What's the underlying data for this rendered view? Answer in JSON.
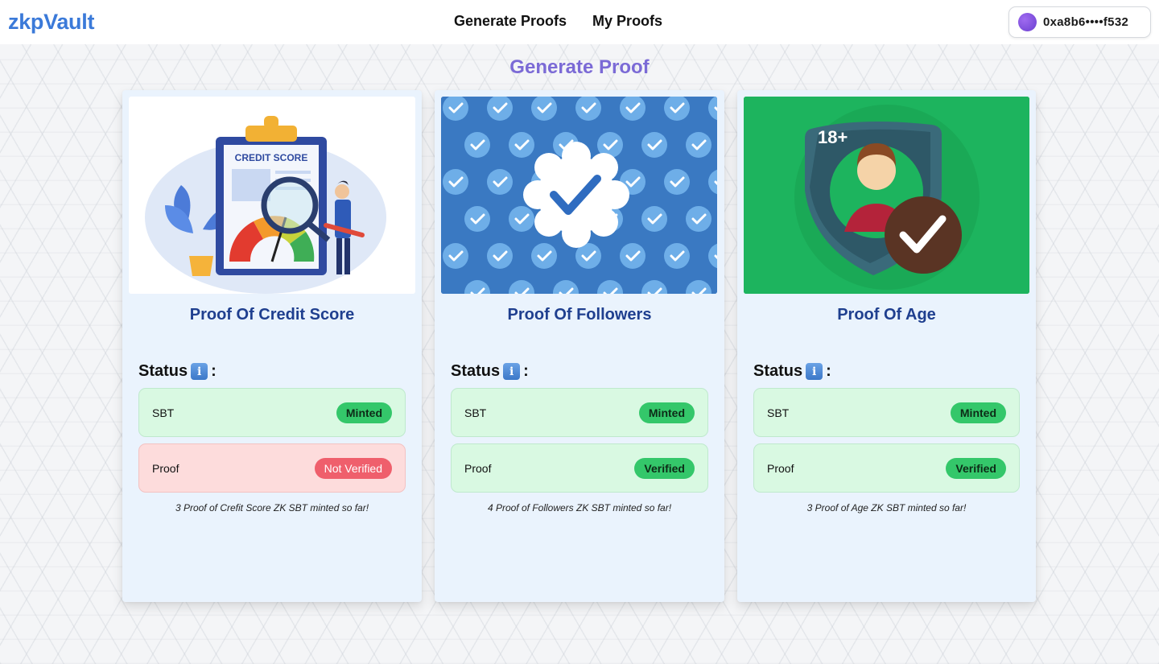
{
  "brand": "zkpVault",
  "nav": [
    {
      "label": "Generate Proofs"
    },
    {
      "label": "My Proofs"
    }
  ],
  "wallet": {
    "address": "0xa8b6••••f532"
  },
  "page_title": "Generate Proof",
  "cards": [
    {
      "title": "Proof Of Credit Score",
      "status_label": "Status",
      "image_text": "CREDIT SCORE",
      "rows": [
        {
          "label": "SBT",
          "badge": "Minted",
          "state": "ok"
        },
        {
          "label": "Proof",
          "badge": "Not Verified",
          "state": "bad"
        }
      ],
      "note": "3 Proof of Crefit Score ZK SBT minted so far!"
    },
    {
      "title": "Proof Of Followers",
      "status_label": "Status",
      "rows": [
        {
          "label": "SBT",
          "badge": "Minted",
          "state": "ok"
        },
        {
          "label": "Proof",
          "badge": "Verified",
          "state": "ok"
        }
      ],
      "note": "4 Proof of Followers ZK SBT minted so far!"
    },
    {
      "title": "Proof Of Age",
      "status_label": "Status",
      "image_text": "18+",
      "rows": [
        {
          "label": "SBT",
          "badge": "Minted",
          "state": "ok"
        },
        {
          "label": "Proof",
          "badge": "Verified",
          "state": "ok"
        }
      ],
      "note": "3 Proof of Age ZK SBT minted so far!"
    }
  ],
  "colors": {
    "brand": "#3b7ad9",
    "title": "#7b6ad6",
    "card_title": "#1f3f8f",
    "ok": "#34c76a",
    "bad": "#ef5f6c"
  }
}
